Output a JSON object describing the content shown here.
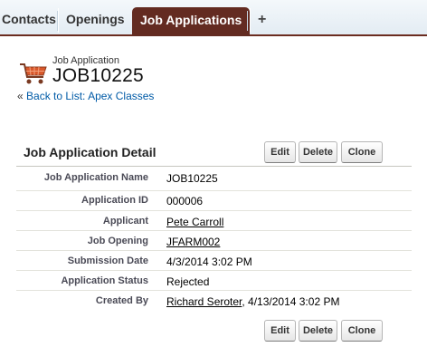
{
  "tabs": [
    {
      "label": "Contacts",
      "active": false
    },
    {
      "label": "Openings",
      "active": false
    },
    {
      "label": "Job Applications",
      "active": true
    },
    {
      "label": "+",
      "active": false
    }
  ],
  "colors": {
    "active_tab": "#632b21",
    "link": "#015ba7",
    "icon": "#d9582b"
  },
  "header": {
    "icon": "shopping-cart-icon",
    "record_type": "Job Application",
    "record_name": "JOB10225",
    "back_prefix": "«",
    "back_link": "Back to List: Apex Classes"
  },
  "detail": {
    "title": "Job Application Detail",
    "buttons": {
      "edit": "Edit",
      "delete": "Delete",
      "clone": "Clone"
    },
    "fields": [
      {
        "label": "Job Application Name",
        "value": "JOB10225",
        "link": false
      },
      {
        "label": "Application ID",
        "value": "000006",
        "link": false
      },
      {
        "label": "Applicant",
        "value": "Pete Carroll",
        "link": true
      },
      {
        "label": "Job Opening",
        "value": "JFARM002",
        "link": true
      },
      {
        "label": "Submission Date",
        "value": "4/3/2014 3:02 PM",
        "link": false
      },
      {
        "label": "Application Status",
        "value": "Rejected",
        "link": false
      },
      {
        "label": "Created By",
        "value": "Richard Seroter",
        "value_suffix": ", 4/13/2014 3:02 PM",
        "link": true
      }
    ]
  }
}
